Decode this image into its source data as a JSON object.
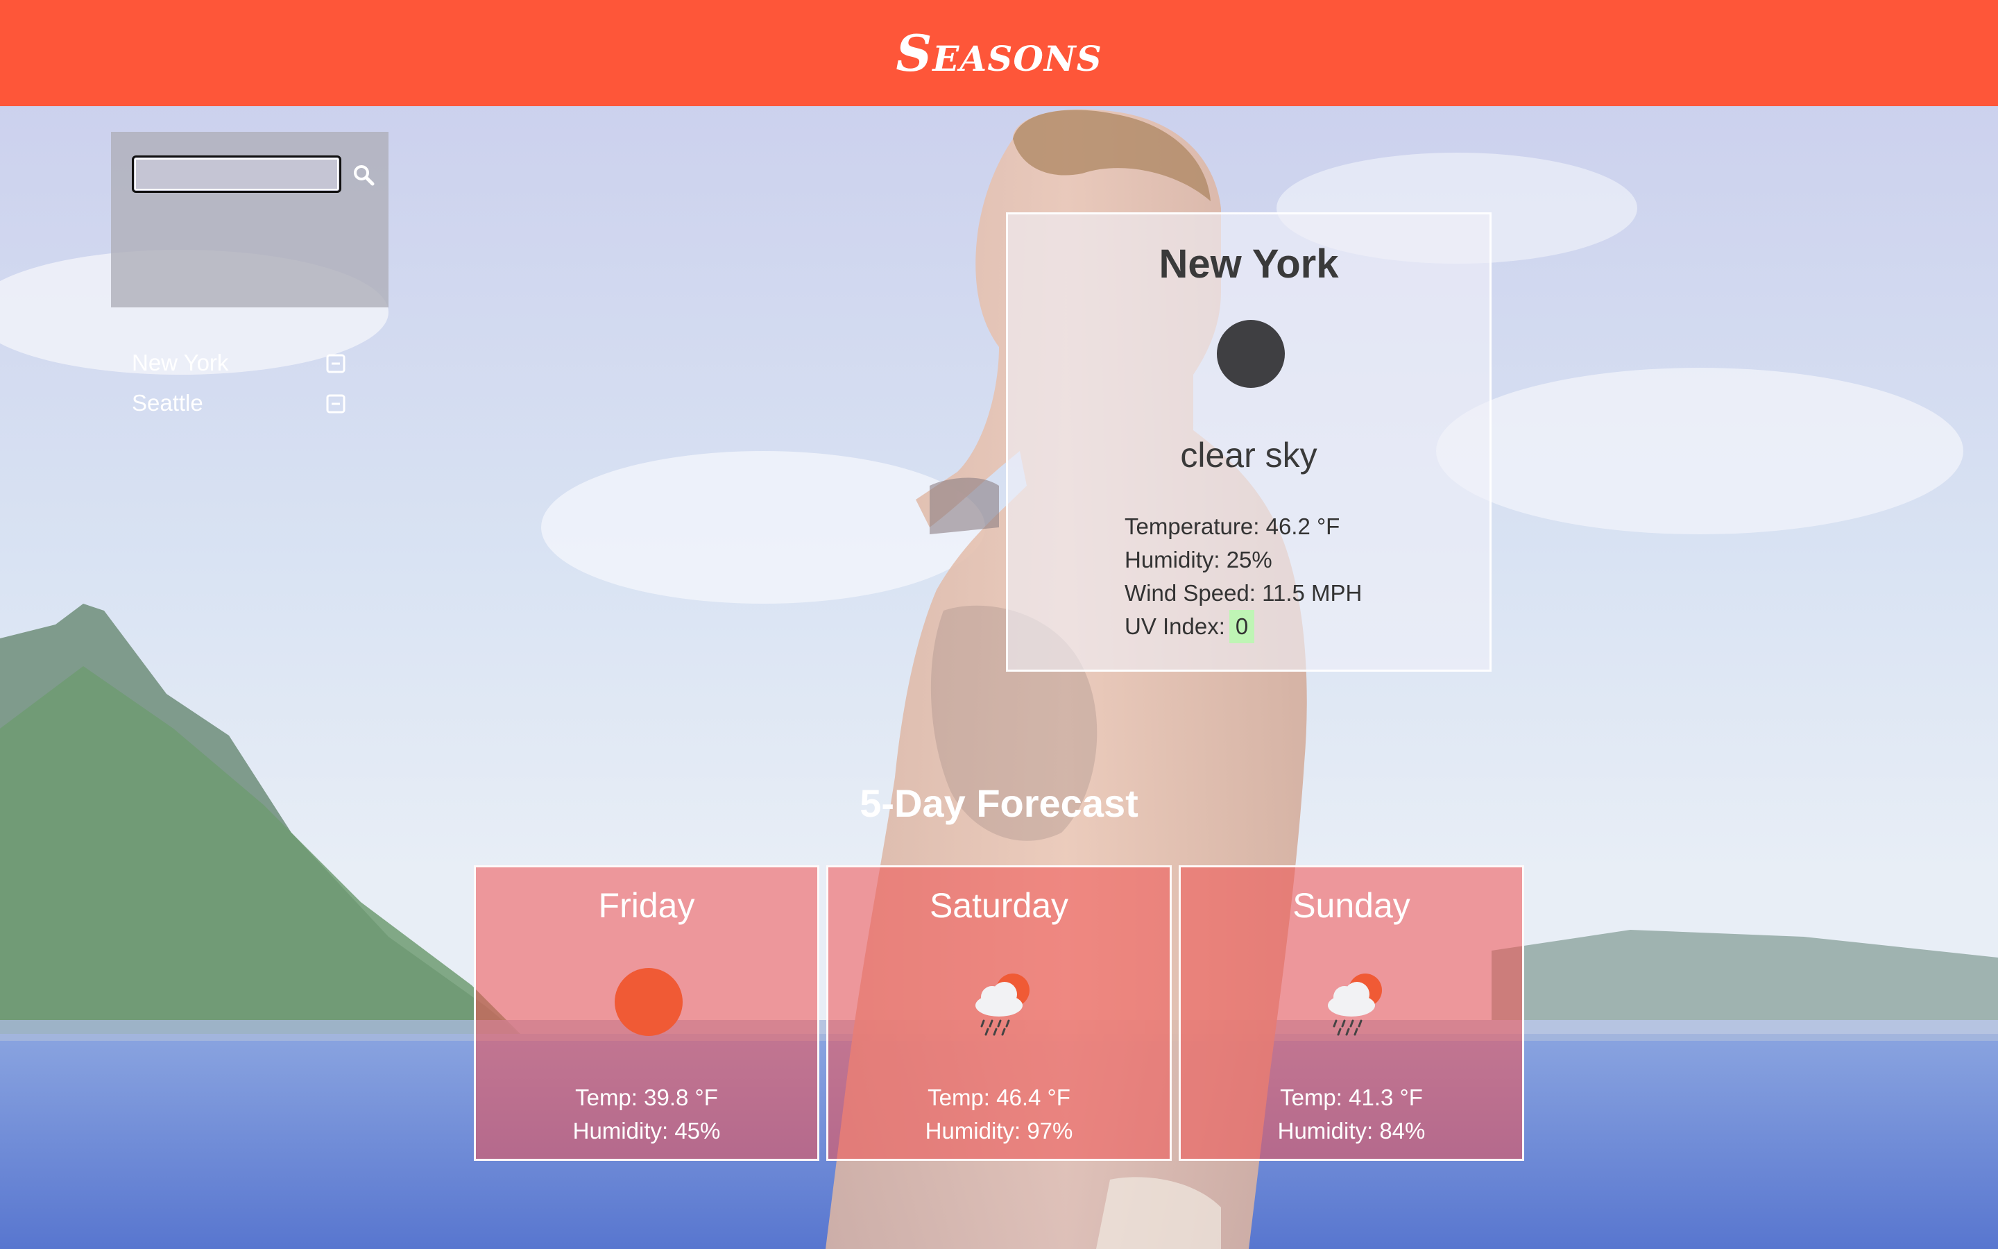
{
  "app": {
    "brand": "Seasons"
  },
  "sidebar": {
    "search": {
      "placeholder": "",
      "value": ""
    },
    "cities": [
      {
        "label": "New York"
      },
      {
        "label": "Seattle"
      }
    ]
  },
  "current": {
    "city": "New York",
    "icon": "clear-sky-icon",
    "description": "clear sky",
    "temperature_label": "Temperature: 46.2 °F",
    "humidity_label": "Humidity: 25%",
    "wind_label": "Wind Speed: 11.5 MPH",
    "uv_label": "UV Index:",
    "uv_value": "0",
    "uv_color": "#bff5b5"
  },
  "forecast": {
    "title": "5-Day Forecast",
    "days": [
      {
        "day": "Friday",
        "icon": "sun-icon",
        "temp": "Temp: 39.8 °F",
        "humidity": "Humidity: 45%"
      },
      {
        "day": "Saturday",
        "icon": "rain-cloud-icon",
        "temp": "Temp: 46.4 °F",
        "humidity": "Humidity: 97%"
      },
      {
        "day": "Sunday",
        "icon": "rain-cloud-icon",
        "temp": "Temp: 41.3 °F",
        "humidity": "Humidity: 84%"
      }
    ]
  },
  "colors": {
    "header": "#fe5639",
    "forecast_card": "#f05050",
    "sun": "#f05a35",
    "current_icon": "#3f3f42"
  }
}
